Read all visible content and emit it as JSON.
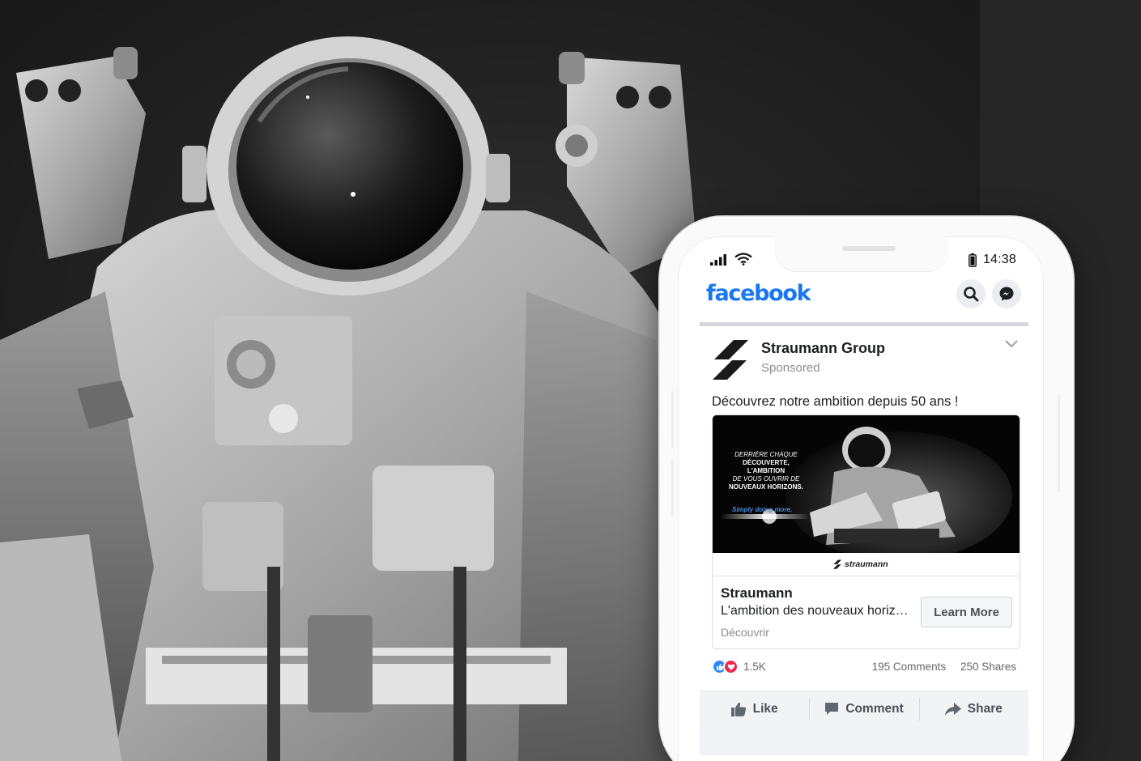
{
  "status_bar": {
    "time": "14:38"
  },
  "facebook": {
    "logo": "facebook"
  },
  "icons": {
    "search": "search-icon",
    "messenger": "messenger-icon",
    "more": "chevron-down-icon",
    "like": "thumbs-up-icon",
    "comment": "comment-icon",
    "share": "share-icon"
  },
  "post": {
    "page_name": "Straumann Group",
    "sponsored_label": "Sponsored",
    "text": "Découvrez notre ambition depuis 50 ans !",
    "ad": {
      "image_headline": [
        "DERRIÈRE CHAQUE",
        "DÉCOUVERTE,",
        "L'AMBITION",
        "DE VOUS OUVRIR DE",
        "NOUVEAUX HORIZONS."
      ],
      "image_tagline": "Simply doing more.",
      "brand": "straumann",
      "title": "Straumann",
      "description": "L'ambition des nouveaux horizons",
      "link_caption": "Découvrir",
      "cta": "Learn More"
    },
    "reactions_count": "1.5K",
    "comments": "195 Comments",
    "shares": "250 Shares",
    "actions": {
      "like": "Like",
      "comment": "Comment",
      "share": "Share"
    }
  },
  "colors": {
    "facebook_blue": "#1877f2",
    "like_blue": "#2d88ff",
    "love_red": "#f0284a",
    "tagline_blue": "#4a8fe0"
  }
}
